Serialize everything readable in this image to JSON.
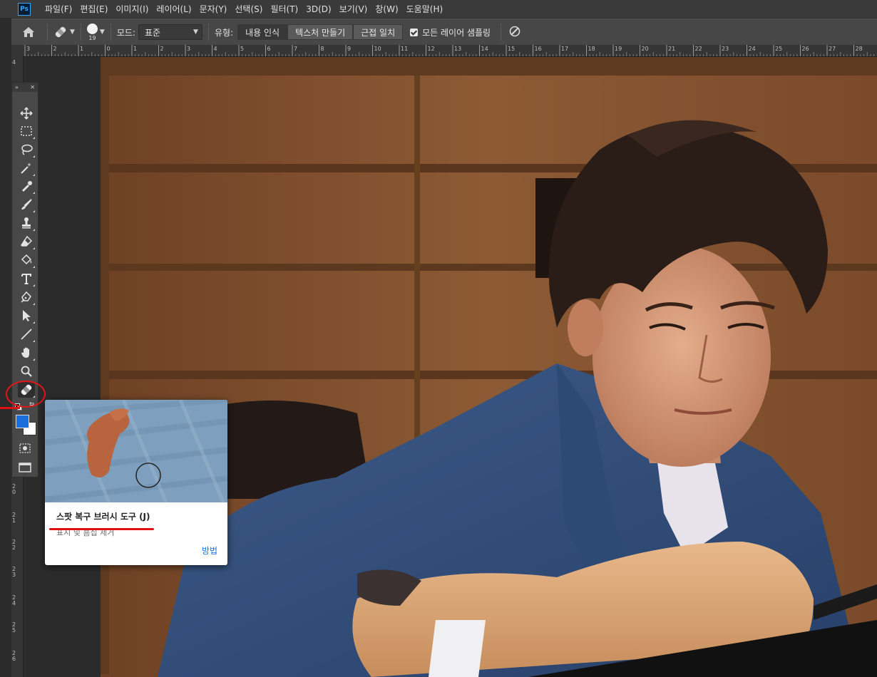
{
  "app": {
    "logo": "Ps"
  },
  "menu": [
    "파일(F)",
    "편집(E)",
    "이미지(I)",
    "레이어(L)",
    "문자(Y)",
    "선택(S)",
    "필터(T)",
    "3D(D)",
    "보기(V)",
    "창(W)",
    "도움말(H)"
  ],
  "options": {
    "brush_size": "19",
    "mode_label": "모드:",
    "mode_value": "표준",
    "type_label": "유형:",
    "type_buttons": [
      "내용 인식",
      "텍스처 만들기",
      "근접 일치"
    ],
    "selected_type_index": 0,
    "sample_all_layers_label": "모든 레이어 샘플링",
    "sample_all_layers_checked": true
  },
  "ruler": {
    "top_ticks": [
      "3",
      "2",
      "1",
      "0",
      "1",
      "2",
      "3",
      "4",
      "5",
      "6",
      "7",
      "8",
      "9",
      "10",
      "11",
      "12",
      "13",
      "14",
      "15",
      "16",
      "17",
      "18",
      "19",
      "20",
      "21",
      "22",
      "23",
      "24",
      "25",
      "26",
      "27",
      "28"
    ],
    "left_ticks": [
      "4",
      "2\n0",
      "2\n1",
      "2\n2",
      "2\n3",
      "2\n4",
      "2\n5",
      "2\n6"
    ]
  },
  "tools": [
    {
      "name": "move-tool",
      "icon": "move-icon"
    },
    {
      "name": "marquee-tool",
      "icon": "marquee-icon"
    },
    {
      "name": "lasso-tool",
      "icon": "lasso-icon"
    },
    {
      "name": "magic-wand-tool",
      "icon": "magic-wand-icon"
    },
    {
      "name": "eyedropper-tool",
      "icon": "eyedropper-icon"
    },
    {
      "name": "brush-tool",
      "icon": "brush-icon"
    },
    {
      "name": "clone-stamp-tool",
      "icon": "stamp-icon"
    },
    {
      "name": "eraser-tool",
      "icon": "eraser-icon"
    },
    {
      "name": "paint-bucket-tool",
      "icon": "paint-bucket-icon"
    },
    {
      "name": "type-tool",
      "icon": "type-icon"
    },
    {
      "name": "pen-tool",
      "icon": "pen-icon"
    },
    {
      "name": "path-selection-tool",
      "icon": "arrow-icon"
    },
    {
      "name": "line-tool",
      "icon": "line-icon"
    },
    {
      "name": "hand-tool",
      "icon": "hand-icon"
    },
    {
      "name": "zoom-tool",
      "icon": "zoom-icon"
    },
    {
      "name": "spot-healing-brush-tool",
      "icon": "bandage-icon",
      "active": true
    }
  ],
  "colors": {
    "foreground": "#1a6fdc",
    "background": "#ffffff",
    "annotation": "#e01010"
  },
  "tooltip": {
    "title": "스팟 복구 브러시 도구 (J)",
    "description": "표시 및 흠집 제거",
    "link": "방법"
  }
}
